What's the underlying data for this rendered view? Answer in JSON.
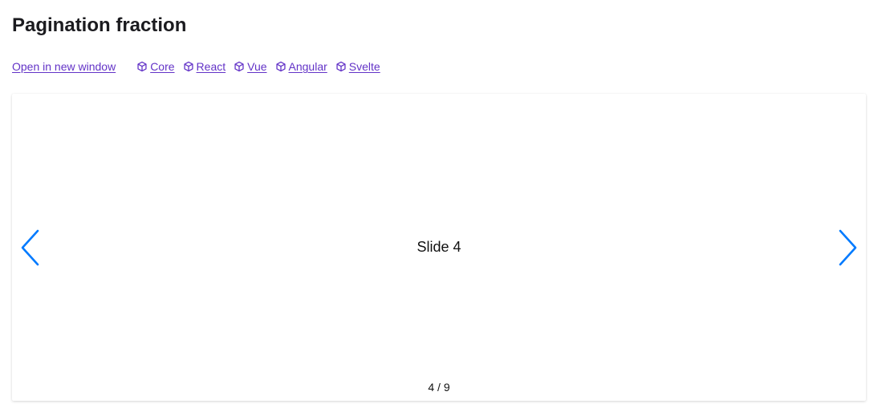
{
  "page": {
    "title": "Pagination fraction"
  },
  "links": {
    "open_new_window": "Open in new window",
    "frameworks": [
      "Core",
      "React",
      "Vue",
      "Angular",
      "Svelte"
    ]
  },
  "slider": {
    "slide_text": "Slide 4",
    "pagination_current": "4",
    "pagination_separator": " / ",
    "pagination_total": "9",
    "current_slide": 4,
    "total_slides": 9
  },
  "icons": {
    "framework": "cube-icon",
    "prev": "chevron-left-icon",
    "next": "chevron-right-icon"
  },
  "colors": {
    "link": "#6333c7",
    "nav_arrow": "#007aff",
    "title": "#1b1b1f"
  }
}
